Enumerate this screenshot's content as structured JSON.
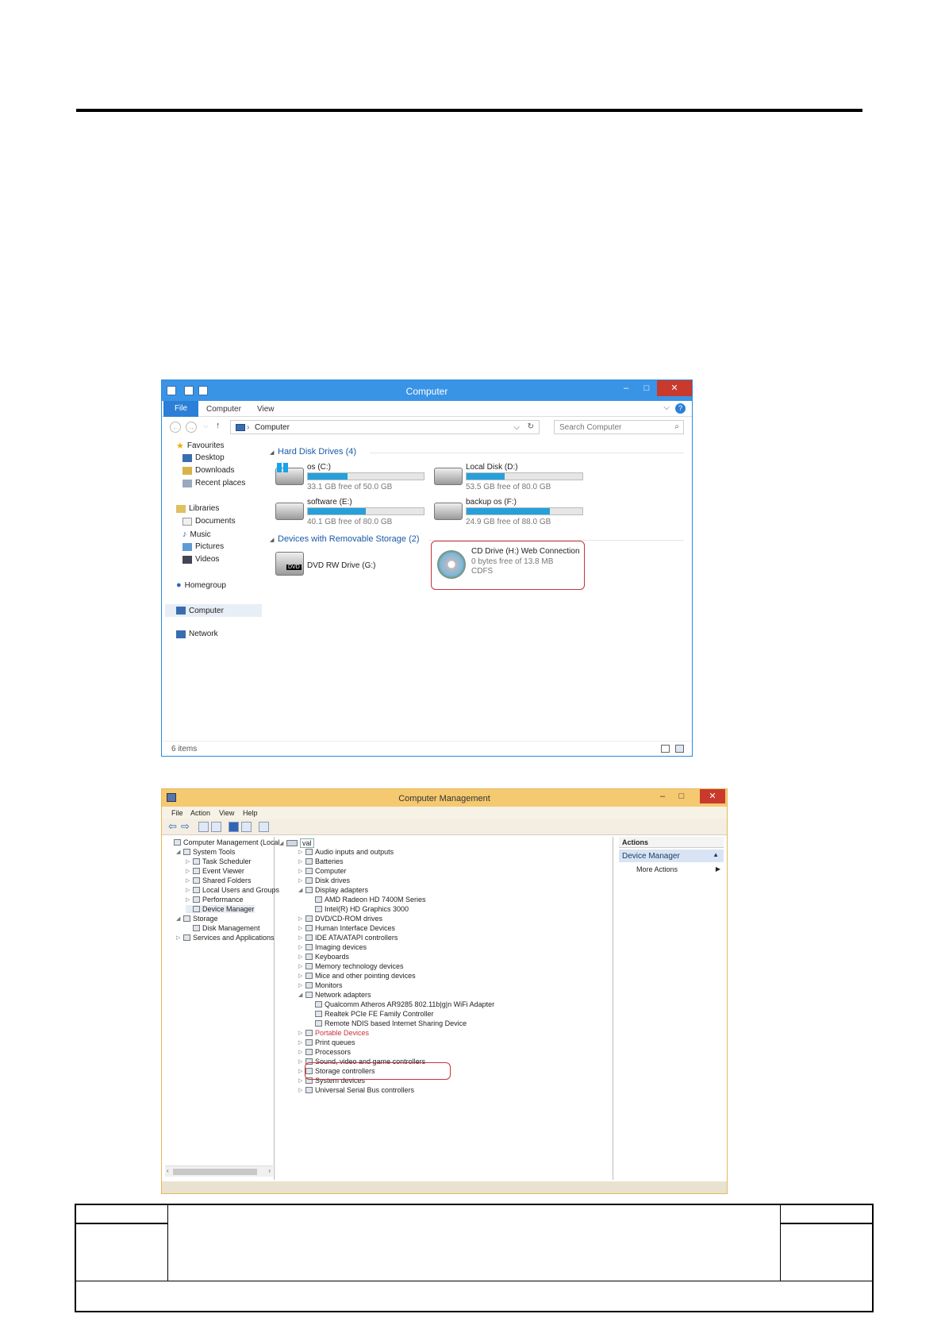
{
  "explorer": {
    "title": "Computer",
    "ribbon": {
      "file": "File",
      "tabs": [
        "Computer",
        "View"
      ],
      "help": "?"
    },
    "address": {
      "path": "Computer",
      "search_placeholder": "Search Computer"
    },
    "nav": {
      "favourites": "Favourites",
      "favourite_items": [
        "Desktop",
        "Downloads",
        "Recent places"
      ],
      "libraries": "Libraries",
      "library_items": [
        "Documents",
        "Music",
        "Pictures",
        "Videos"
      ],
      "homegroup": "Homegroup",
      "computer": "Computer",
      "network": "Network"
    },
    "groups": {
      "hard_disks": "Hard Disk Drives (4)",
      "removable": "Devices with Removable Storage (2)"
    },
    "drives": [
      {
        "name": "os (C:)",
        "free": "33.1 GB free of 50.0 GB",
        "used_fraction": 0.34
      },
      {
        "name": "Local Disk (D:)",
        "free": "53.5 GB free of 80.0 GB",
        "used_fraction": 0.33
      },
      {
        "name": "software (E:)",
        "free": "40.1 GB free of 80.0 GB",
        "used_fraction": 0.5
      },
      {
        "name": "backup os (F:)",
        "free": "24.9 GB free of 88.0 GB",
        "used_fraction": 0.72
      }
    ],
    "removable": [
      {
        "name": "DVD RW Drive (G:)",
        "badge": "DVD"
      },
      {
        "name": "CD Drive (H:) Web Connection",
        "free": "0 bytes free of 13.8 MB",
        "fs": "CDFS"
      }
    ],
    "status": "6 items",
    "colors": {
      "titlebar": "#3a94e6",
      "bar_fill": "#26a0da",
      "highlight": "#c8323c"
    }
  },
  "cm": {
    "title": "Computer Management",
    "menu": [
      "File",
      "Action",
      "View",
      "Help"
    ],
    "left_tree": [
      {
        "label": "Computer Management (Local",
        "level": 0,
        "twisty": ""
      },
      {
        "label": "System Tools",
        "level": 1,
        "twisty": "◢"
      },
      {
        "label": "Task Scheduler",
        "level": 2,
        "twisty": "▷"
      },
      {
        "label": "Event Viewer",
        "level": 2,
        "twisty": "▷"
      },
      {
        "label": "Shared Folders",
        "level": 2,
        "twisty": "▷"
      },
      {
        "label": "Local Users and Groups",
        "level": 2,
        "twisty": "▷"
      },
      {
        "label": "Performance",
        "level": 2,
        "twisty": "▷"
      },
      {
        "label": "Device Manager",
        "level": 2,
        "twisty": ""
      },
      {
        "label": "Storage",
        "level": 1,
        "twisty": "◢"
      },
      {
        "label": "Disk Management",
        "level": 2,
        "twisty": ""
      },
      {
        "label": "Services and Applications",
        "level": 1,
        "twisty": "▷"
      }
    ],
    "device_root": "val",
    "devices": [
      {
        "label": "Audio inputs and outputs",
        "level": 1,
        "twisty": "▷"
      },
      {
        "label": "Batteries",
        "level": 1,
        "twisty": "▷"
      },
      {
        "label": "Computer",
        "level": 1,
        "twisty": "▷"
      },
      {
        "label": "Disk drives",
        "level": 1,
        "twisty": "▷"
      },
      {
        "label": "Display adapters",
        "level": 1,
        "twisty": "◢"
      },
      {
        "label": "AMD Radeon HD 7400M Series",
        "level": 2,
        "twisty": ""
      },
      {
        "label": "Intel(R) HD Graphics 3000",
        "level": 2,
        "twisty": ""
      },
      {
        "label": "DVD/CD-ROM drives",
        "level": 1,
        "twisty": "▷"
      },
      {
        "label": "Human Interface Devices",
        "level": 1,
        "twisty": "▷"
      },
      {
        "label": "IDE ATA/ATAPI controllers",
        "level": 1,
        "twisty": "▷"
      },
      {
        "label": "Imaging devices",
        "level": 1,
        "twisty": "▷"
      },
      {
        "label": "Keyboards",
        "level": 1,
        "twisty": "▷"
      },
      {
        "label": "Memory technology devices",
        "level": 1,
        "twisty": "▷"
      },
      {
        "label": "Mice and other pointing devices",
        "level": 1,
        "twisty": "▷"
      },
      {
        "label": "Monitors",
        "level": 1,
        "twisty": "▷"
      },
      {
        "label": "Network adapters",
        "level": 1,
        "twisty": "◢"
      },
      {
        "label": "Qualcomm Atheros AR9285 802.11b|g|n WiFi Adapter",
        "level": 2,
        "twisty": ""
      },
      {
        "label": "Realtek PCIe FE Family Controller",
        "level": 2,
        "twisty": ""
      },
      {
        "label": "Remote NDIS based Internet Sharing Device",
        "level": 2,
        "twisty": ""
      },
      {
        "label": "Portable Devices",
        "level": 1,
        "twisty": "▷"
      },
      {
        "label": "Print queues",
        "level": 1,
        "twisty": "▷"
      },
      {
        "label": "Processors",
        "level": 1,
        "twisty": "▷"
      },
      {
        "label": "Sound, video and game controllers",
        "level": 1,
        "twisty": "▷"
      },
      {
        "label": "Storage controllers",
        "level": 1,
        "twisty": "▷"
      },
      {
        "label": "System devices",
        "level": 1,
        "twisty": "▷"
      },
      {
        "label": "Universal Serial Bus controllers",
        "level": 1,
        "twisty": "▷"
      }
    ],
    "actions": {
      "header": "Actions",
      "section": "Device Manager",
      "more": "More Actions"
    },
    "colors": {
      "titlebar": "#f5c970",
      "highlight": "#c8323c"
    }
  }
}
